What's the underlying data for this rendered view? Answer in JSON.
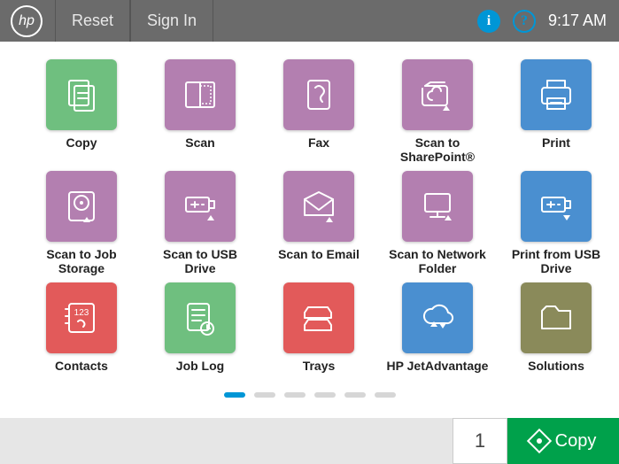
{
  "header": {
    "reset": "Reset",
    "signin": "Sign In",
    "info_icon": "i",
    "help_icon": "?",
    "clock": "9:17 AM"
  },
  "tiles": [
    {
      "label": "Copy",
      "color": "#6fbf7f",
      "icon": "copy"
    },
    {
      "label": "Scan",
      "color": "#b37fb0",
      "icon": "scan"
    },
    {
      "label": "Fax",
      "color": "#b37fb0",
      "icon": "fax"
    },
    {
      "label": "Scan to\nSharePoint®",
      "color": "#b37fb0",
      "icon": "sharepoint"
    },
    {
      "label": "Print",
      "color": "#4a8fd0",
      "icon": "print"
    },
    {
      "label": "Scan to Job\nStorage",
      "color": "#b37fb0",
      "icon": "jobstorage"
    },
    {
      "label": "Scan to USB Drive",
      "color": "#b37fb0",
      "icon": "scanusb"
    },
    {
      "label": "Scan to Email",
      "color": "#b37fb0",
      "icon": "email"
    },
    {
      "label": "Scan to Network\nFolder",
      "color": "#b37fb0",
      "icon": "network"
    },
    {
      "label": "Print from USB\nDrive",
      "color": "#4a8fd0",
      "icon": "printusb"
    },
    {
      "label": "Contacts",
      "color": "#e25a5a",
      "icon": "contacts"
    },
    {
      "label": "Job Log",
      "color": "#6fbf7f",
      "icon": "joblog"
    },
    {
      "label": "Trays",
      "color": "#e25a5a",
      "icon": "trays"
    },
    {
      "label": "HP JetAdvantage",
      "color": "#4a8fd0",
      "icon": "cloud"
    },
    {
      "label": "Solutions",
      "color": "#8a8a5a",
      "icon": "folder"
    }
  ],
  "pagination": {
    "pages": 6,
    "active": 0
  },
  "footer": {
    "count": "1",
    "action": "Copy"
  }
}
